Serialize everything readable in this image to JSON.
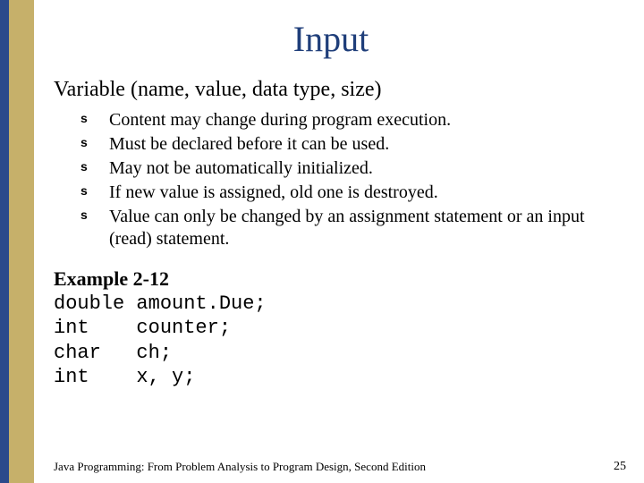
{
  "title": "Input",
  "subheading": "Variable (name, value, data type, size)",
  "bullets": [
    "Content may change during program execution.",
    "Must be declared before it can be used.",
    "May not be automatically initialized.",
    "If new value is assigned, old one is destroyed.",
    "Value can only be changed by an assignment statement or an input (read) statement."
  ],
  "example": {
    "title": "Example 2-12",
    "lines": [
      "double amount.Due;",
      "int    counter;",
      "char   ch;",
      "int    x, y;"
    ]
  },
  "footer_text": "Java Programming: From Problem Analysis to Program Design, Second Edition",
  "page_number": "25"
}
